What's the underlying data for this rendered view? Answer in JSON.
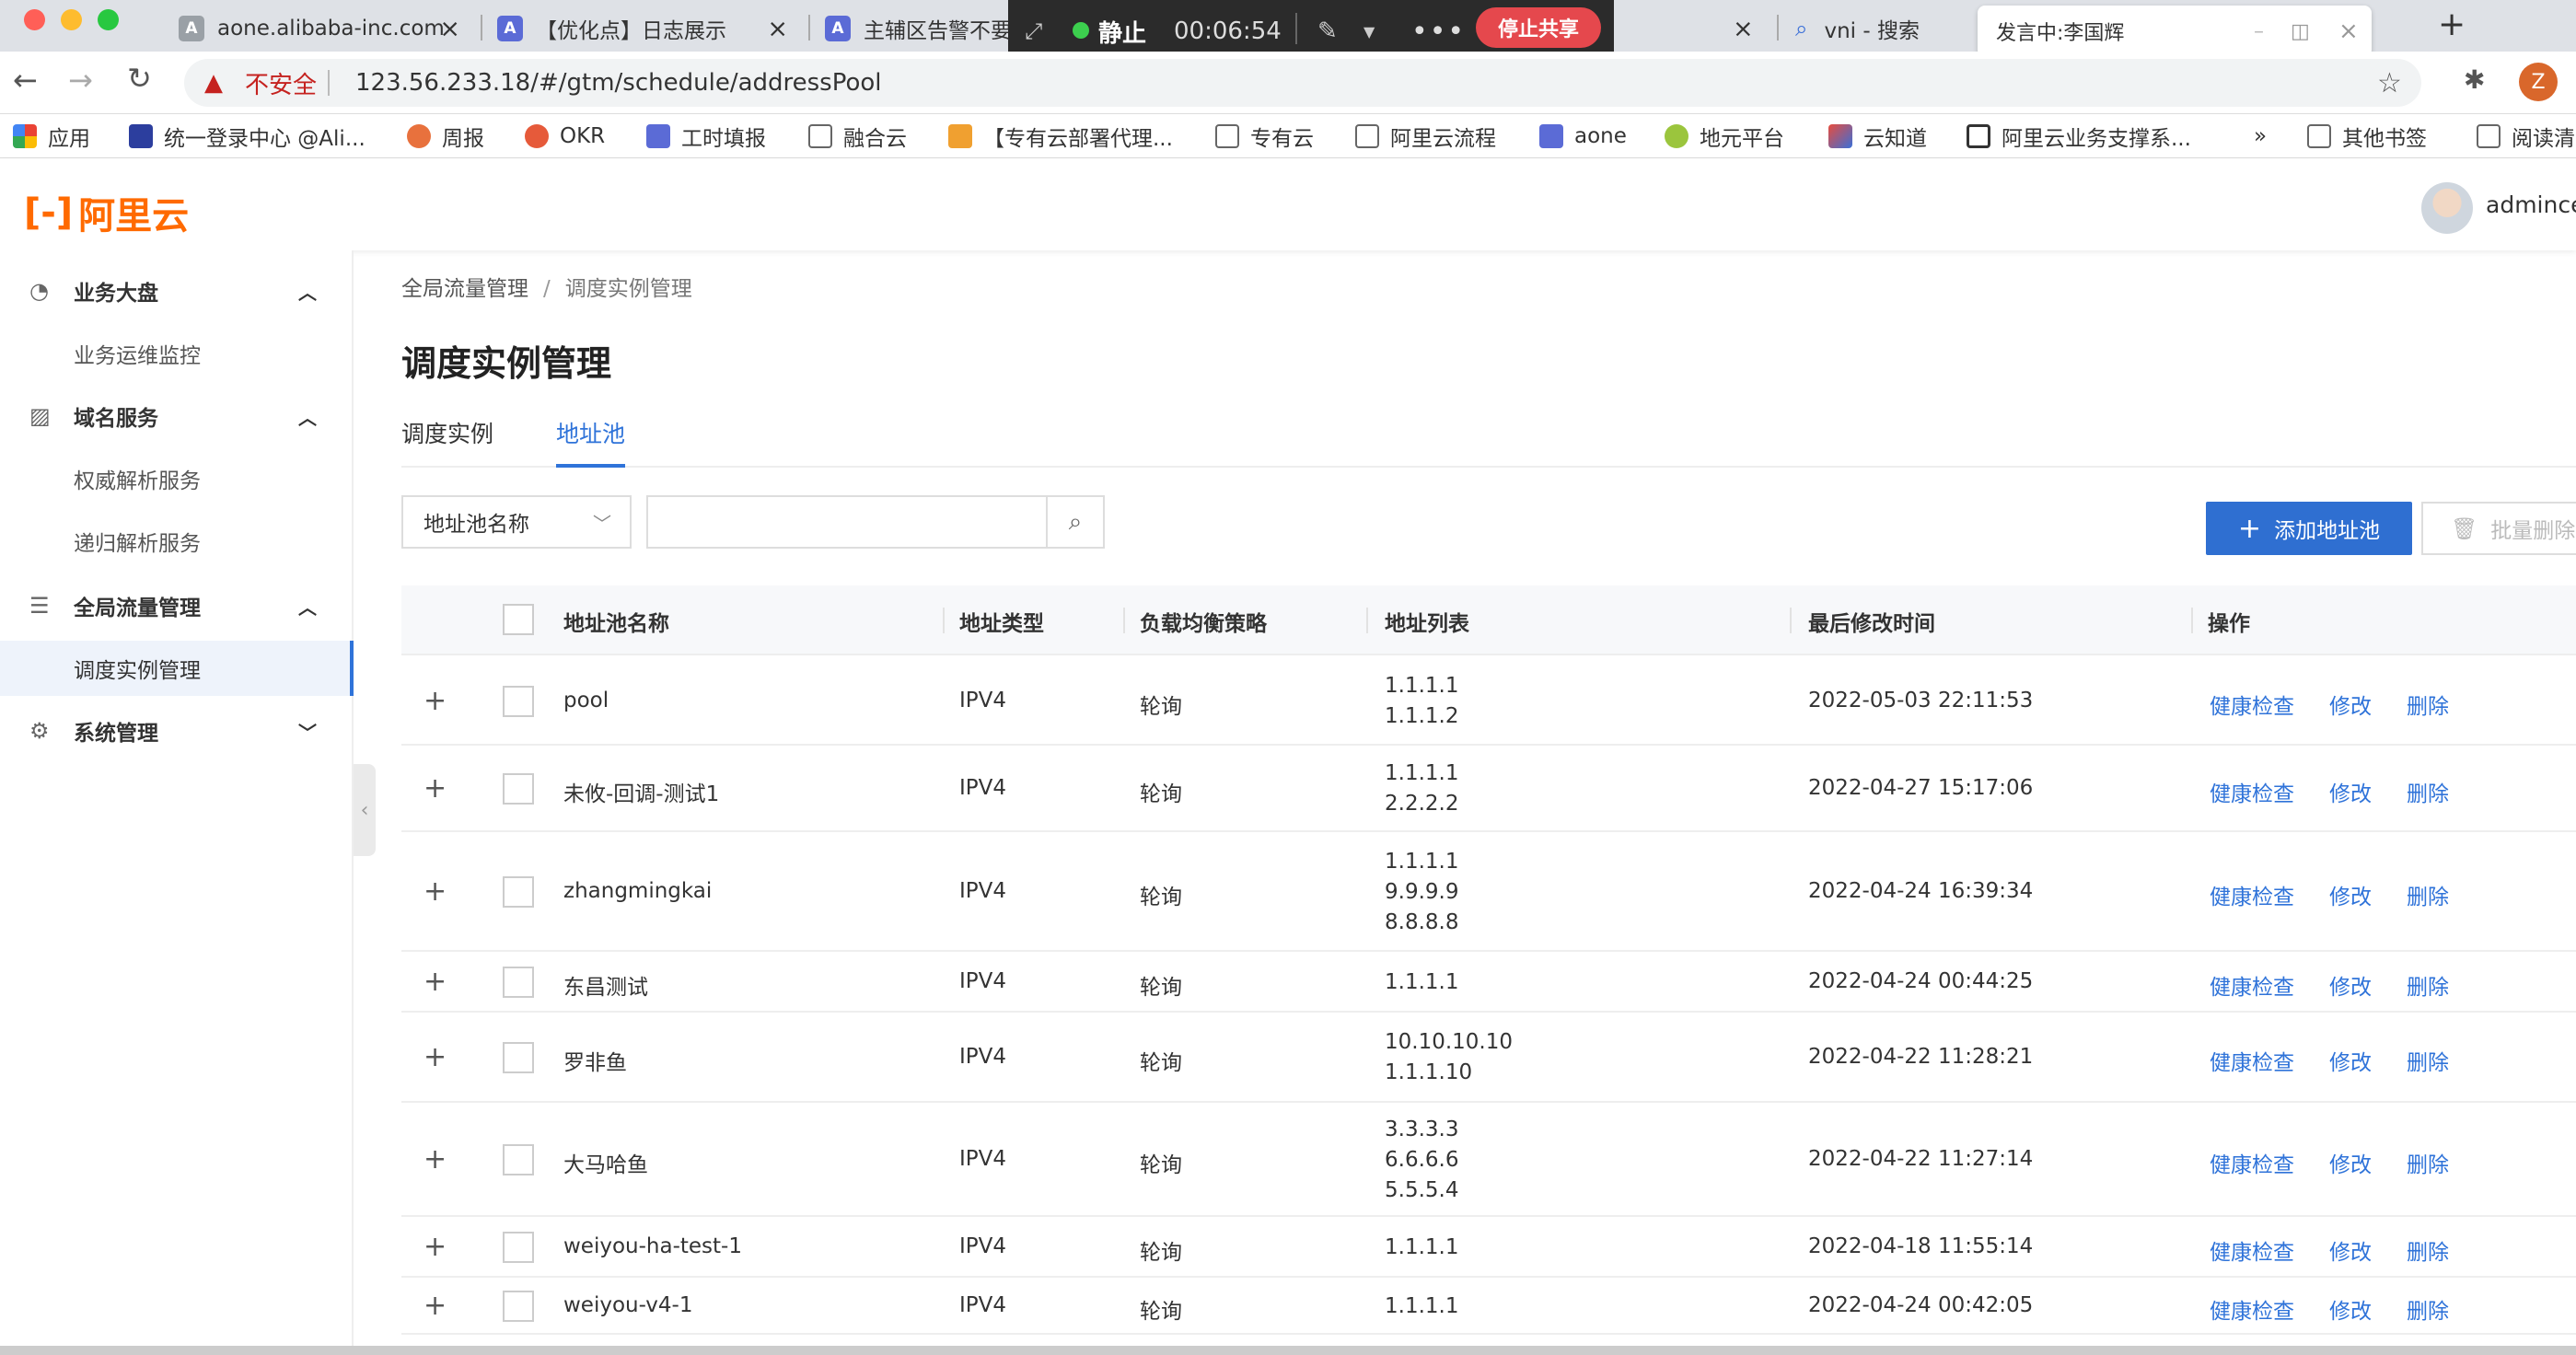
{
  "browser": {
    "tabs": [
      {
        "title": "aone.alibaba-inc.com",
        "icon": "A",
        "grey": true
      },
      {
        "title": "【优化点】日志展示",
        "icon": "A"
      },
      {
        "title": "主辅区告警不要",
        "icon": "A"
      },
      {
        "title": "",
        "icon": ""
      },
      {
        "title": "vni - 搜索",
        "icon": "search"
      }
    ],
    "share_bar": {
      "status": "静止",
      "timer": "00:06:54",
      "stop_label": "停止共享"
    },
    "speaker_label": "发言中:李国辉",
    "insecure_label": "不安全",
    "url": "123.56.233.18/#/gtm/schedule/addressPool",
    "profile_initial": "Z",
    "bookmarks": [
      "应用",
      "统一登录中心 @Ali...",
      "周报",
      "OKR",
      "工时填报",
      "融合云",
      "【专有云部署代理...",
      "专有云",
      "阿里云流程",
      "aone",
      "地元平台",
      "云知道",
      "阿里云业务支撑系...",
      "»",
      "其他书签",
      "阅读清单"
    ]
  },
  "header": {
    "logo_text": "阿里云",
    "username": "admince"
  },
  "sidebar": {
    "groups": [
      {
        "label": "业务大盘",
        "items": [
          "业务运维监控"
        ]
      },
      {
        "label": "域名服务",
        "items": [
          "权威解析服务",
          "递归解析服务"
        ]
      },
      {
        "label": "全局流量管理",
        "items": [
          "调度实例管理"
        ]
      },
      {
        "label": "系统管理",
        "items": []
      }
    ]
  },
  "main": {
    "breadcrumb": [
      "全局流量管理",
      "调度实例管理"
    ],
    "title": "调度实例管理",
    "tabs": [
      "调度实例",
      "地址池"
    ],
    "active_tab": 1,
    "filter": {
      "select_value": "地址池名称",
      "search_placeholder": ""
    },
    "add_button": "添加地址池",
    "batch_delete_button": "批量删除",
    "table": {
      "columns": [
        "地址池名称",
        "地址类型",
        "负载均衡策略",
        "地址列表",
        "最后修改时间",
        "操作"
      ],
      "actions": [
        "健康检查",
        "修改",
        "删除"
      ],
      "rows": [
        {
          "name": "pool",
          "type": "IPV4",
          "strategy": "轮询",
          "addresses": [
            "1.1.1.1",
            "1.1.1.2"
          ],
          "modified": "2022-05-03 22:11:53"
        },
        {
          "name": "未攸-回调-测试1",
          "type": "IPV4",
          "strategy": "轮询",
          "addresses": [
            "1.1.1.1",
            "2.2.2.2"
          ],
          "modified": "2022-04-27 15:17:06"
        },
        {
          "name": "zhangmingkai",
          "type": "IPV4",
          "strategy": "轮询",
          "addresses": [
            "1.1.1.1",
            "9.9.9.9",
            "8.8.8.8"
          ],
          "modified": "2022-04-24 16:39:34"
        },
        {
          "name": "东昌测试",
          "type": "IPV4",
          "strategy": "轮询",
          "addresses": [
            "1.1.1.1"
          ],
          "modified": "2022-04-24 00:44:25"
        },
        {
          "name": "罗非鱼",
          "type": "IPV4",
          "strategy": "轮询",
          "addresses": [
            "10.10.10.10",
            "1.1.1.10"
          ],
          "modified": "2022-04-22 11:28:21"
        },
        {
          "name": "大马哈鱼",
          "type": "IPV4",
          "strategy": "轮询",
          "addresses": [
            "3.3.3.3",
            "6.6.6.6",
            "5.5.5.4"
          ],
          "modified": "2022-04-22 11:27:14"
        },
        {
          "name": "weiyou-ha-test-1",
          "type": "IPV4",
          "strategy": "轮询",
          "addresses": [
            "1.1.1.1"
          ],
          "modified": "2022-04-18 11:55:14"
        },
        {
          "name": "weiyou-v4-1",
          "type": "IPV4",
          "strategy": "轮询",
          "addresses": [
            "1.1.1.1"
          ],
          "modified": "2022-04-24 00:42:05"
        }
      ]
    }
  },
  "colors": {
    "accent": "#2f73d9",
    "brand": "#ff6a00",
    "primary_button": "#2f6fd1"
  }
}
